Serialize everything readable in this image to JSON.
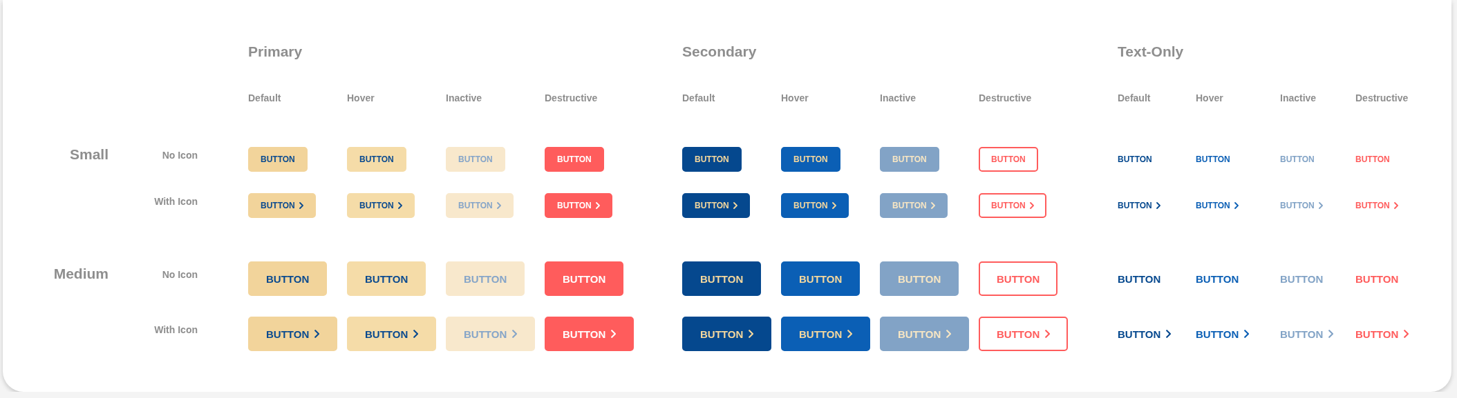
{
  "groups": [
    {
      "title": "Primary",
      "states": [
        {
          "label": "Default"
        },
        {
          "label": "Hover"
        },
        {
          "label": "Inactive"
        },
        {
          "label": "Destructive"
        }
      ]
    },
    {
      "title": "Secondary",
      "states": [
        {
          "label": "Default"
        },
        {
          "label": "Hover"
        },
        {
          "label": "Inactive"
        },
        {
          "label": "Destructive"
        }
      ]
    },
    {
      "title": "Text-Only",
      "states": [
        {
          "label": "Default"
        },
        {
          "label": "Hover"
        },
        {
          "label": "Inactive"
        },
        {
          "label": "Destructive"
        }
      ]
    }
  ],
  "sizes": [
    {
      "label": "Small",
      "rows": [
        {
          "label": "No Icon",
          "icon": false,
          "cells": [
            "BUTTON",
            "BUTTON",
            "BUTTON",
            "BUTTON",
            "BUTTON",
            "BUTTON",
            "BUTTON",
            "BUTTON",
            "BUTTON",
            "BUTTON",
            "BUTTON",
            "BUTTON"
          ]
        },
        {
          "label": "With Icon",
          "icon": true,
          "cells": [
            "BUTTON",
            "BUTTON",
            "BUTTON",
            "BUTTON",
            "BUTTON",
            "BUTTON",
            "BUTTON",
            "BUTTON",
            "BUTTON",
            "BUTTON",
            "BUTTON",
            "BUTTON"
          ]
        }
      ]
    },
    {
      "label": "Medium",
      "rows": [
        {
          "label": "No Icon",
          "icon": false,
          "cells": [
            "BUTTON",
            "BUTTON",
            "BUTTON",
            "BUTTON",
            "BUTTON",
            "BUTTON",
            "BUTTON",
            "BUTTON",
            "BUTTON",
            "BUTTON",
            "BUTTON",
            "BUTTON"
          ]
        },
        {
          "label": "With Icon",
          "icon": true,
          "cells": [
            "BUTTON",
            "BUTTON",
            "BUTTON",
            "BUTTON",
            "BUTTON",
            "BUTTON",
            "BUTTON",
            "BUTTON",
            "BUTTON",
            "BUTTON",
            "BUTTON",
            "BUTTON"
          ]
        }
      ]
    }
  ]
}
